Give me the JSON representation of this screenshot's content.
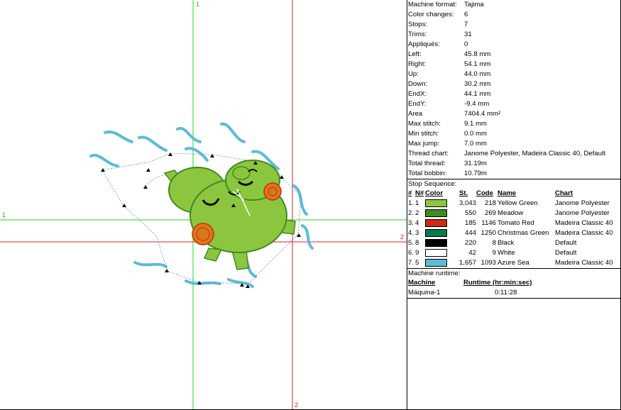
{
  "guides": {
    "green_top": "1",
    "green_left": "1",
    "red_right": "2",
    "red_bottom": "2"
  },
  "summary": [
    {
      "label": "Machine format:",
      "value": "Tajima"
    },
    {
      "label": "Color changes:",
      "value": "6"
    },
    {
      "label": "Stops:",
      "value": "7"
    },
    {
      "label": "Trims:",
      "value": "31"
    },
    {
      "label": "Appliqués:",
      "value": "0"
    },
    {
      "label": "Left:",
      "value": "45.8 mm"
    },
    {
      "label": "Right:",
      "value": "54.1 mm"
    },
    {
      "label": "Up:",
      "value": "44.0 mm"
    },
    {
      "label": "Down:",
      "value": "30.2 mm"
    },
    {
      "label": "EndX:",
      "value": "44.1 mm"
    },
    {
      "label": "EndY:",
      "value": "-9.4 mm"
    },
    {
      "label": "Area",
      "value": "7404.4 mm²"
    },
    {
      "label": "Max stitch:",
      "value": "9.1 mm"
    },
    {
      "label": "Min stitch:",
      "value": "0.0 mm"
    },
    {
      "label": "Max jump:",
      "value": "7.0 mm"
    },
    {
      "label": "Thread chart:",
      "value": "Janome Polyester, Madeira Classic 40, Default"
    },
    {
      "label": "Total thread:",
      "value": "31.19m"
    },
    {
      "label": "Total bobbin:",
      "value": "10.79m"
    }
  ],
  "stop_sequence": {
    "title": "Stop Sequence:",
    "headers": {
      "num": "#",
      "n": "N#",
      "color": "Color",
      "st": "St.",
      "code": "Code",
      "name": "Name",
      "chart": "Chart"
    },
    "rows": [
      {
        "num": "1.",
        "n": "1",
        "color": "#8cc63e",
        "st": "3,043",
        "code": "218",
        "name": "Yellow Green",
        "chart": "Janome Polyester"
      },
      {
        "num": "2.",
        "n": "2",
        "color": "#3f8a22",
        "st": "550",
        "code": "269",
        "name": "Meadow",
        "chart": "Janome Polyester"
      },
      {
        "num": "3.",
        "n": "4",
        "color": "#cc2a12",
        "st": "185",
        "code": "1146",
        "name": "Tomato Red",
        "chart": "Madeira Classic 40"
      },
      {
        "num": "4.",
        "n": "3",
        "color": "#077a4b",
        "st": "444",
        "code": "1250",
        "name": "Christmas Green",
        "chart": "Madeira Classic 40"
      },
      {
        "num": "5.",
        "n": "8",
        "color": "#000000",
        "st": "220",
        "code": "8",
        "name": "Black",
        "chart": "Default"
      },
      {
        "num": "6.",
        "n": "9",
        "color": "#ffffff",
        "st": "42",
        "code": "9",
        "name": "White",
        "chart": "Default"
      },
      {
        "num": "7.",
        "n": "5",
        "color": "#5bbcd8",
        "st": "1,657",
        "code": "1093",
        "name": "Azure Sea",
        "chart": "Madeira Classic 40"
      }
    ]
  },
  "runtime": {
    "title": "Machine runtime:",
    "col_machine": "Machine",
    "col_runtime": "Runtime (hr:min:sec)",
    "rows": [
      {
        "machine": "Máquina-1",
        "runtime": "0:11:28"
      }
    ]
  }
}
